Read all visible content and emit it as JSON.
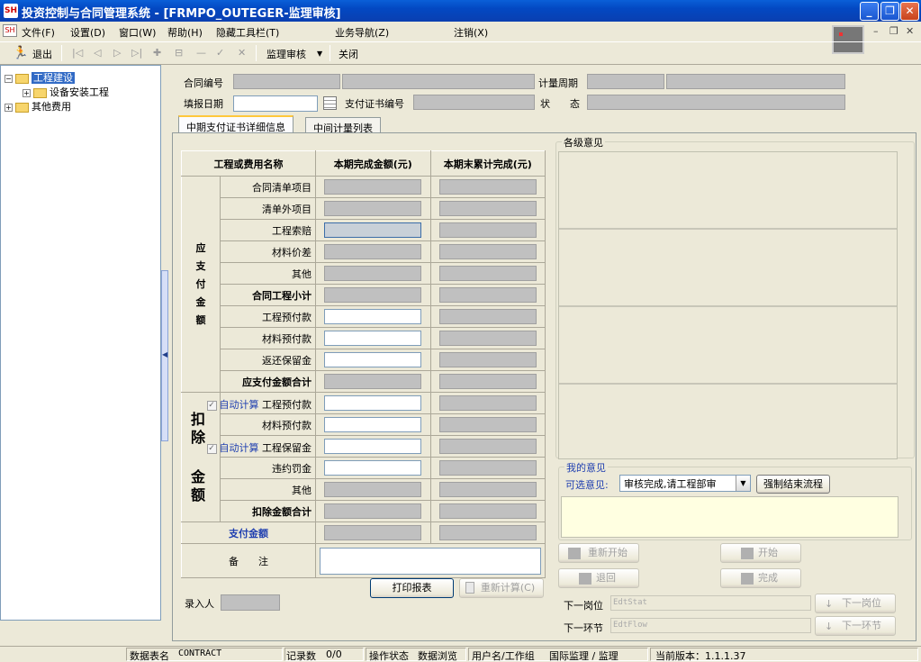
{
  "window": {
    "title": "投资控制与合同管理系统 - [FRMPO_OUTEGER-监理审核]",
    "icon": "SH"
  },
  "menu": [
    "文件(F)",
    "设置(D)",
    "窗口(W)",
    "帮助(H)",
    "隐藏工具栏(T)",
    "业务导航(Z)",
    "注销(X)"
  ],
  "toolbar": {
    "exit": "退出",
    "review": "监理审核",
    "close": "关闭"
  },
  "tree": {
    "root1": "工程建设",
    "child1": "设备安装工程",
    "root2": "其他费用"
  },
  "header": {
    "contract_no_label": "合同编号",
    "period_label": "计量周期",
    "fill_date_label": "填报日期",
    "cert_no_label": "支付证书编号",
    "status_label": "状　　态"
  },
  "tabs": [
    "中期支付证书详细信息",
    "中间计量列表"
  ],
  "grid": {
    "col_name": "工程或费用名称",
    "col_current": "本期完成金额(元)",
    "col_cumulative": "本期末累计完成(元)",
    "group_payable": "应支付金额",
    "group_deduct_top": "扣除",
    "group_deduct_bottom": "金额",
    "payable_rows": [
      "合同清单项目",
      "清单外项目",
      "工程索赔",
      "材料价差",
      "其他",
      "合同工程小计",
      "工程预付款",
      "材料预付款",
      "返还保留金",
      "应支付金额合计"
    ],
    "deduct_rows": [
      "工程预付款",
      "材料预付款",
      "工程保留金",
      "违约罚金",
      "其他",
      "扣除金额合计"
    ],
    "auto_calc": "自动计算",
    "pay_amount": "支付金额",
    "remarks": "备　　注"
  },
  "print_button": "打印报表",
  "recalc_button": "重新计算(C)",
  "entry_label": "录入人",
  "opinions": {
    "all_title": "各级意见",
    "my_title": "我的意见",
    "optional_label": "可选意见:",
    "optional_value": "审核完成,请工程部审",
    "force_end": "强制结束流程"
  },
  "actions": {
    "restart": "重新开始",
    "start": "开始",
    "back": "退回",
    "finish": "完成"
  },
  "next": {
    "post_label": "下一岗位",
    "post_value": "EdtStat",
    "post_button": "下一岗位",
    "step_label": "下一环节",
    "step_value": "EdtFlow",
    "step_button": "下一环节"
  },
  "status": {
    "table_label": "数据表名",
    "table_value": "CONTRACT",
    "records_label": "记录数",
    "records_value": "0/0",
    "op_label": "操作状态",
    "op_value": "数据浏览",
    "user_label": "用户名/工作组",
    "user_value": "国际监理 / 监理",
    "version": "当前版本：1.1.1.37"
  }
}
